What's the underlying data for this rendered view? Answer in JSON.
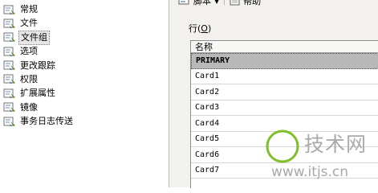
{
  "sidebar": {
    "items": [
      {
        "label": "常规"
      },
      {
        "label": "文件"
      },
      {
        "label": "文件组",
        "selected": true
      },
      {
        "label": "选项"
      },
      {
        "label": "更改跟踪"
      },
      {
        "label": "权限"
      },
      {
        "label": "扩展属性"
      },
      {
        "label": "镜像"
      },
      {
        "label": "事务日志传送"
      }
    ]
  },
  "toolbar": {
    "script_label": "脚本",
    "help_label": "帮助"
  },
  "content": {
    "rows_label": "行",
    "rows_hotkey": "O",
    "grid": {
      "header": "名称",
      "rows": [
        "PRIMARY",
        "Card1",
        "Card2",
        "Card3",
        "Card4",
        "Card5",
        "Card6",
        "Card7"
      ]
    }
  },
  "watermark": {
    "brand": "技术网",
    "url": "www.itjs.cn"
  },
  "colors": {
    "accent_green": "#7fbf2a",
    "accent_orange": "#e8842a",
    "selection_gray": "#b8b8b8"
  }
}
